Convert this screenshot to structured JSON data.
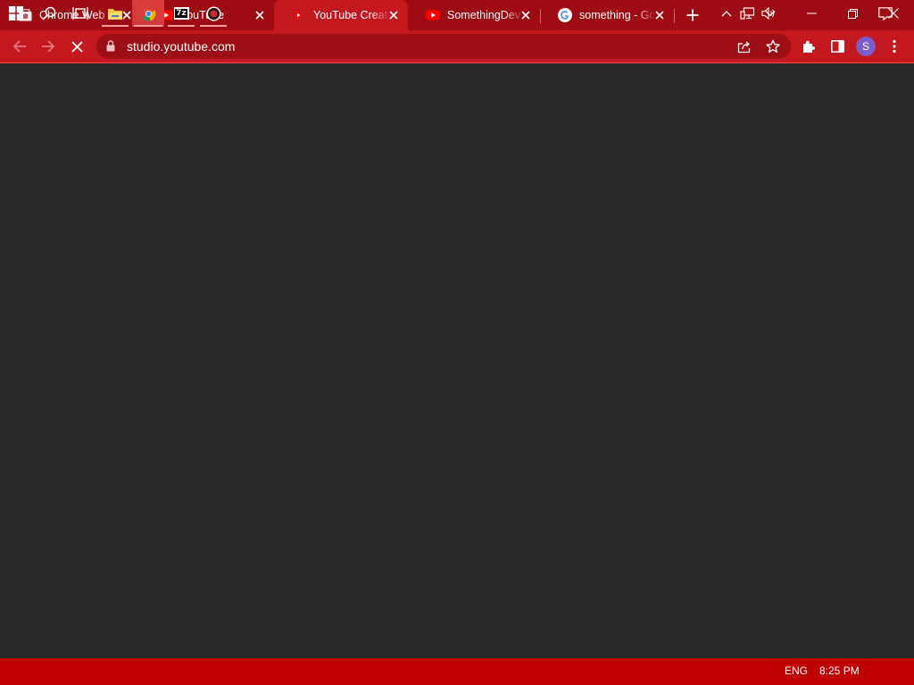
{
  "browser": {
    "tabs": [
      {
        "title": "Chrome Web Store",
        "icon": "chrome-web-store-icon",
        "active": false
      },
      {
        "title": "YouTube",
        "icon": "youtube-icon",
        "active": false
      },
      {
        "title": "YouTube Creator Studio",
        "icon": "youtube-studio-icon",
        "active": true
      },
      {
        "title": "SomethingDev",
        "icon": "youtube-icon",
        "active": false
      },
      {
        "title": "something - Google Search",
        "icon": "google-icon",
        "active": false
      }
    ],
    "url": "studio.youtube.com",
    "profile_initial": "S"
  },
  "taskbar": {
    "language": "ENG",
    "time": "8:25 PM",
    "apps": [
      "file-explorer-icon",
      "chrome-icon",
      "7zip-icon",
      "obs-icon"
    ],
    "sevenzip_label": "7z"
  },
  "colors": {
    "tabstrip": "#9e0b12",
    "active_tab": "#c41820",
    "toolbar": "#c41820",
    "omnibox": "#9b0f15",
    "page": "#282828",
    "taskbar": "#c00000",
    "youtube_red": "#ff0000",
    "profile_avatar": "#7b5cc9"
  }
}
